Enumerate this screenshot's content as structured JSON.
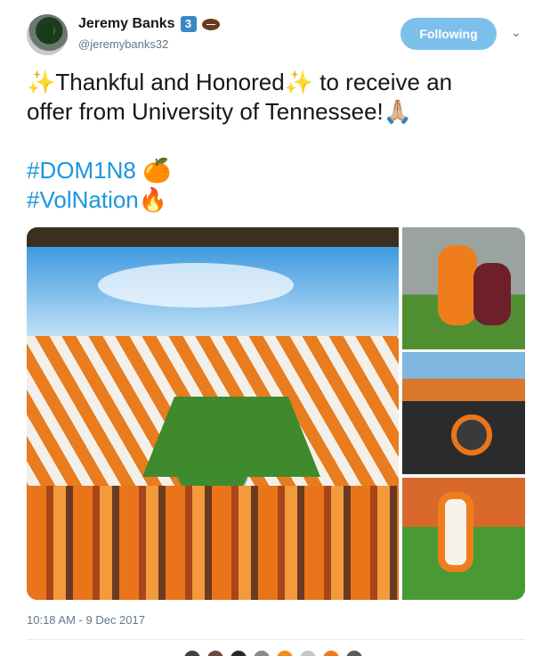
{
  "user": {
    "display_name": "Jeremy Banks",
    "badge": "3",
    "handle": "@jeremybanks32"
  },
  "actions": {
    "follow_label": "Following"
  },
  "tweet": {
    "line1_a": "Thankful and Honored",
    "line1_b": " to receive an",
    "line2": "offer from University of Tennessee!",
    "hashtag1": "#DOM1N8",
    "hashtag2": "#VolNation",
    "sparkle": "✨",
    "praying": "🙏🏼",
    "orange": "🍊",
    "fire": "🔥"
  },
  "meta": {
    "timestamp": "10:18 AM - 9 Dec 2017"
  },
  "icons": {
    "football": "football-icon",
    "chevron": "chevron-down-icon"
  },
  "colors": {
    "accent": "#1b95e0",
    "follow_bg": "#7dbfeb",
    "text": "#14171a",
    "muted": "#657786"
  }
}
